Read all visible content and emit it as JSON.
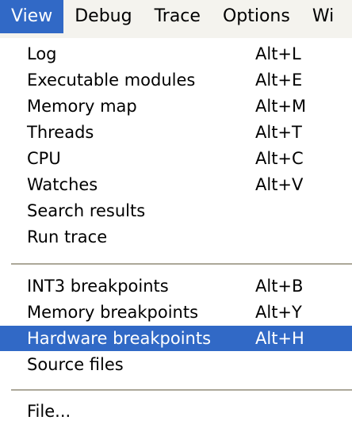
{
  "menubar": {
    "items": [
      {
        "label": "View",
        "active": true
      },
      {
        "label": "Debug",
        "active": false
      },
      {
        "label": "Trace",
        "active": false
      },
      {
        "label": "Options",
        "active": false
      },
      {
        "label": "Wi",
        "active": false
      }
    ]
  },
  "view_menu": {
    "items": [
      {
        "label": "Log",
        "shortcut": "Alt+L"
      },
      {
        "label": "Executable modules",
        "shortcut": "Alt+E"
      },
      {
        "label": "Memory map",
        "shortcut": "Alt+M"
      },
      {
        "label": "Threads",
        "shortcut": "Alt+T"
      },
      {
        "label": "CPU",
        "shortcut": "Alt+C"
      },
      {
        "label": "Watches",
        "shortcut": "Alt+V"
      },
      {
        "label": "Search results",
        "shortcut": ""
      },
      {
        "label": "Run trace",
        "shortcut": ""
      },
      {
        "label": "INT3 breakpoints",
        "shortcut": "Alt+B"
      },
      {
        "label": "Memory breakpoints",
        "shortcut": "Alt+Y"
      },
      {
        "label": "Hardware breakpoints",
        "shortcut": "Alt+H",
        "highlighted": true
      },
      {
        "label": "Source files",
        "shortcut": ""
      },
      {
        "label": "File...",
        "shortcut": ""
      }
    ]
  },
  "colors": {
    "highlight": "#3169c6",
    "menubar_bg": "#f4f3ee",
    "separator": "#aca899"
  }
}
